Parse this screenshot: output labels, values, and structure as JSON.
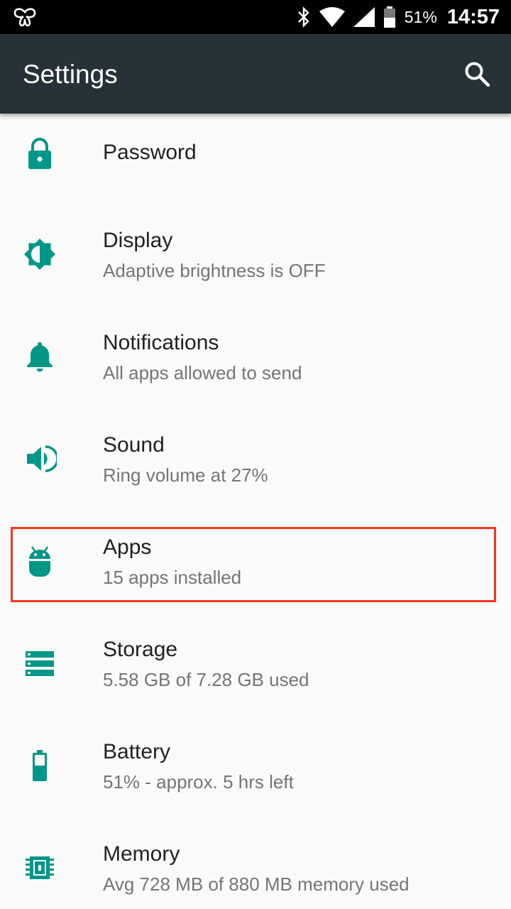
{
  "status_bar": {
    "left_icon": "butterfly-icon",
    "icons": [
      "bluetooth-icon",
      "wifi-icon",
      "signal-icon",
      "battery-icon"
    ],
    "battery_percent": "51%",
    "time": "14:57"
  },
  "app_bar": {
    "title": "Settings",
    "search_icon": "search-icon",
    "background": "#263238"
  },
  "accent_color": "#009688",
  "items": [
    {
      "title": "Password",
      "subtitle": "",
      "icon": "lock-icon"
    },
    {
      "title": "Display",
      "subtitle": "Adaptive brightness is OFF",
      "icon": "brightness-icon"
    },
    {
      "title": "Notifications",
      "subtitle": "All apps allowed to send",
      "icon": "bell-icon"
    },
    {
      "title": "Sound",
      "subtitle": "Ring volume at 27%",
      "icon": "volume-icon"
    },
    {
      "title": "Apps",
      "subtitle": "15 apps installed",
      "icon": "android-icon"
    },
    {
      "title": "Storage",
      "subtitle": "5.58 GB of 7.28 GB used",
      "icon": "storage-icon"
    },
    {
      "title": "Battery",
      "subtitle": "51% - approx. 5 hrs left",
      "icon": "battery-icon"
    },
    {
      "title": "Memory",
      "subtitle": "Avg 728 MB of 880 MB memory used",
      "icon": "memory-chip-icon"
    }
  ],
  "highlighted_item": "Apps"
}
